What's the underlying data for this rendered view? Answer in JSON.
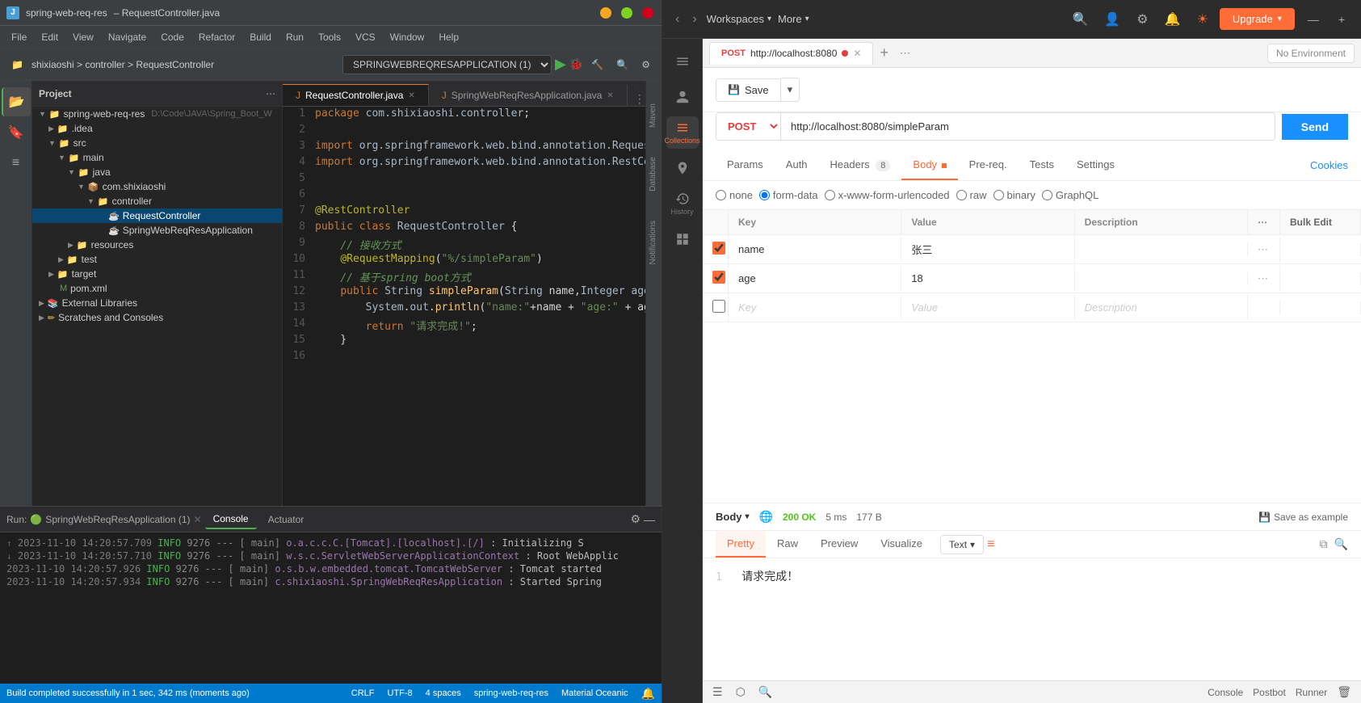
{
  "ide": {
    "title": "spring-web-req-res",
    "breadcrumb": "shixiaoshi > controller > RequestController",
    "menu": [
      "File",
      "Edit",
      "View",
      "Navigate",
      "Code",
      "Refactor",
      "Build",
      "Run",
      "Tools",
      "VCS",
      "Window",
      "Help"
    ],
    "toolbar": {
      "dropdown": "SPRINGWEBREQRESAPPLICATION (1)",
      "run_label": "Run"
    },
    "tabs": [
      {
        "name": "RequestController.java",
        "active": true
      },
      {
        "name": "SpringWebReqResApplication.java",
        "active": false
      }
    ],
    "code_lines": [
      {
        "num": 1,
        "content": "package com.shixiaoshi.controller;"
      },
      {
        "num": 2,
        "content": ""
      },
      {
        "num": 3,
        "content": "import org.springframework.web.bind.annotation.RequestMapping;"
      },
      {
        "num": 4,
        "content": "import org.springframework.web.bind.annotation.RestController;"
      },
      {
        "num": 5,
        "content": ""
      },
      {
        "num": 6,
        "content": ""
      },
      {
        "num": 7,
        "content": "@RestController"
      },
      {
        "num": 8,
        "content": "public class RequestController {"
      },
      {
        "num": 9,
        "content": "    // 接收方式"
      },
      {
        "num": 10,
        "content": "    @RequestMapping(\"%/simpleParam\")"
      },
      {
        "num": 11,
        "content": "    // 基于spring boot方式"
      },
      {
        "num": 12,
        "content": "    public String simpleParam(String name,Integer age){"
      },
      {
        "num": 13,
        "content": "        System.out.println(\"name:\"+name + \"age:\" + age);"
      },
      {
        "num": 14,
        "content": "        return \"请求完成!\";"
      },
      {
        "num": 15,
        "content": "    }"
      },
      {
        "num": 16,
        "content": ""
      }
    ],
    "project": {
      "title": "Project",
      "root": "spring-web-req-res",
      "path": "D:\\Code\\JAVA\\Spring_Boot_W",
      "items": [
        {
          "label": ".idea",
          "indent": 1,
          "type": "folder"
        },
        {
          "label": "src",
          "indent": 1,
          "type": "folder",
          "expanded": true
        },
        {
          "label": "main",
          "indent": 2,
          "type": "folder",
          "expanded": true
        },
        {
          "label": "java",
          "indent": 3,
          "type": "folder",
          "expanded": true
        },
        {
          "label": "com.shixiaoshi",
          "indent": 4,
          "type": "folder",
          "expanded": true
        },
        {
          "label": "controller",
          "indent": 5,
          "type": "folder",
          "expanded": true
        },
        {
          "label": "RequestController",
          "indent": 6,
          "type": "class",
          "selected": true
        },
        {
          "label": "SpringWebReqResApplication",
          "indent": 6,
          "type": "class"
        },
        {
          "label": "resources",
          "indent": 3,
          "type": "folder"
        },
        {
          "label": "test",
          "indent": 2,
          "type": "folder"
        },
        {
          "label": "target",
          "indent": 1,
          "type": "folder"
        },
        {
          "label": "pom.xml",
          "indent": 1,
          "type": "xml"
        },
        {
          "label": "External Libraries",
          "indent": 0,
          "type": "folder"
        },
        {
          "label": "Scratches and Consoles",
          "indent": 0,
          "type": "folder"
        }
      ]
    },
    "bottom": {
      "run_label": "Run:",
      "app_name": "SpringWebReqResApplication (1)",
      "tabs": [
        "Console",
        "Actuator"
      ],
      "active_tab": "Console",
      "logs": [
        {
          "time": "2023-11-10 14:20:57.709",
          "level": "INFO",
          "pid": "9276",
          "thread": "main",
          "msg": "o.a.c.c.C.[Tomcat].[localhost].[/]",
          "detail": ": Initializing S"
        },
        {
          "time": "2023-11-10 14:20:57.710",
          "level": "INFO",
          "pid": "9276",
          "thread": "main",
          "msg": "w.s.c.ServletWebServerApplicationContext",
          "detail": ": Root WebApplic"
        },
        {
          "time": "2023-11-10 14:20:57.926",
          "level": "INFO",
          "pid": "9276",
          "thread": "main",
          "msg": "o.s.b.w.embedded.tomcat.TomcatWebServer",
          "detail": ": Tomcat started"
        },
        {
          "time": "2023-11-10 14:20:57.934",
          "level": "INFO",
          "pid": "9276",
          "thread": "main",
          "msg": "c.shixiaoshi.SpringWebReqResApplication",
          "detail": ": Started Spring"
        }
      ]
    },
    "statusbar": {
      "build": "Build completed successfully in 1 sec, 342 ms (moments ago)",
      "encoding": "CRLF",
      "charset": "UTF-8",
      "indent": "4 spaces",
      "branch": "spring-web-req-res",
      "theme": "Material Oceanic"
    },
    "sidebar_labels": [
      "Bookmarks",
      "Structure"
    ],
    "maven_label": "Maven",
    "notifications_label": "Notifications",
    "database_label": "Database"
  },
  "postman": {
    "topbar": {
      "workspace_label": "Workspaces",
      "more_label": "More",
      "upgrade_label": "Upgrade"
    },
    "sidebar": {
      "items": [
        {
          "icon": "person",
          "label": ""
        },
        {
          "icon": "collections",
          "label": "Collections",
          "active": true
        },
        {
          "icon": "globe",
          "label": "Environments"
        },
        {
          "icon": "history",
          "label": "History"
        },
        {
          "icon": "grid",
          "label": ""
        }
      ]
    },
    "request_tab": {
      "name": "POST http://localhost:8080",
      "has_dot": true
    },
    "url_bar": {
      "method": "POST",
      "url": "http://localhost:8080/simpleParam",
      "save_label": "Save",
      "environment": "No Environment"
    },
    "request_tabs": [
      "Params",
      "Auth",
      "Headers",
      "Body",
      "Pre-req.",
      "Tests",
      "Settings"
    ],
    "headers_count": "8",
    "active_req_tab": "Body",
    "cookies_label": "Cookies",
    "body_type": "form-data",
    "params_table": {
      "headers": [
        "",
        "Key",
        "Value",
        "Description",
        "...",
        "Bulk Edit"
      ],
      "rows": [
        {
          "checked": true,
          "key": "name",
          "value": "张三",
          "description": ""
        },
        {
          "checked": true,
          "key": "age",
          "value": "18",
          "description": ""
        },
        {
          "checked": false,
          "key": "Key",
          "value": "Value",
          "description": "Description",
          "empty": true
        }
      ]
    },
    "response": {
      "label": "Body",
      "status": "200 OK",
      "time": "5 ms",
      "size": "177 B",
      "save_example": "Save as example",
      "tabs": [
        "Pretty",
        "Raw",
        "Preview",
        "Visualize"
      ],
      "active_tab": "Pretty",
      "text_format": "Text",
      "content": "请求完成！",
      "line_num": "1"
    },
    "statusbar": {
      "postbot_label": "Postbot",
      "runner_label": "Runner"
    }
  }
}
